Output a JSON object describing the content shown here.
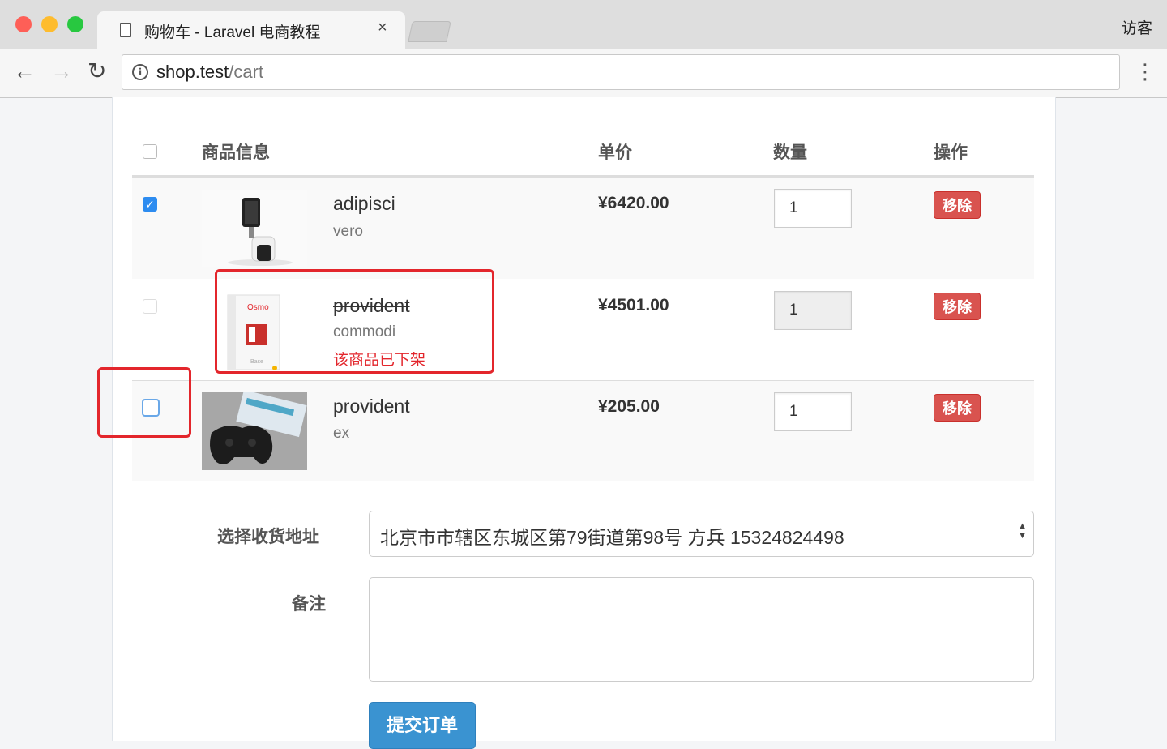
{
  "browser": {
    "tab_title": "购物车 - Laravel 电商教程",
    "tab_close": "×",
    "user_label": "访客",
    "url_host": "shop.test",
    "url_path": "/cart",
    "back": "←",
    "forward": "→",
    "reload": "↻",
    "menu": "⋮",
    "info": "i",
    "light_colors": [
      "#fe5f57",
      "#febc2e",
      "#28c840"
    ]
  },
  "table": {
    "headers": {
      "product": "商品信息",
      "price": "单价",
      "quantity": "数量",
      "action": "操作"
    },
    "rows": [
      {
        "name": "adipisci",
        "sku": "vero",
        "price": "¥6420.00",
        "quantity": "1",
        "remove": "移除",
        "checked": true,
        "on_sale": true
      },
      {
        "name": "provident",
        "sku": "commodi",
        "price": "¥4501.00",
        "quantity": "1",
        "remove": "移除",
        "checked": false,
        "on_sale": false,
        "status": "该商品已下架"
      },
      {
        "name": "provident",
        "sku": "ex",
        "price": "¥205.00",
        "quantity": "1",
        "remove": "移除",
        "checked": false,
        "on_sale": true
      }
    ]
  },
  "form": {
    "address_label": "选择收货地址",
    "address_value": "北京市市辖区东城区第79街道第98号 方兵 15324824498",
    "remark_label": "备注",
    "remark_value": "",
    "submit_label": "提交订单"
  },
  "colors": {
    "remove_button": "#d9534f",
    "submit_button": "#3a93d1",
    "annotation_box": "#e3262c",
    "checkbox_checked": "#2d8cf0"
  }
}
